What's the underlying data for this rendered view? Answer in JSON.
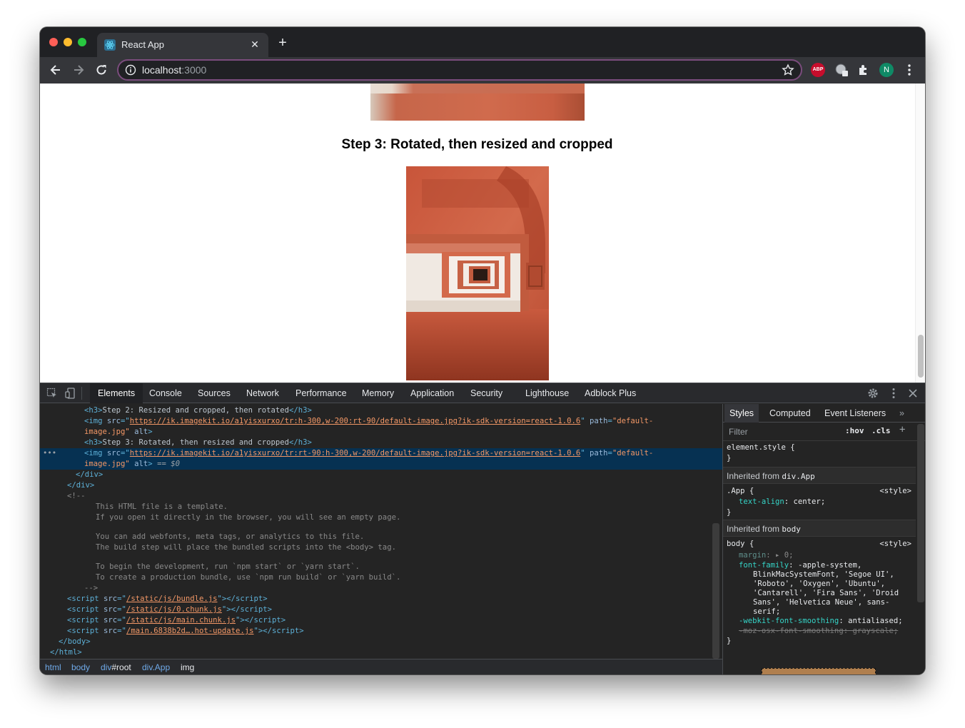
{
  "browser": {
    "tab_title": "React App",
    "url_host": "localhost",
    "url_port": ":3000",
    "profile_initial": "N",
    "abp_label": "ABP"
  },
  "page": {
    "heading": "Step 3: Rotated, then resized and cropped"
  },
  "devtools": {
    "tabs": [
      "Elements",
      "Console",
      "Sources",
      "Network",
      "Performance",
      "Memory",
      "Application",
      "Security",
      "Lighthouse",
      "Adblock Plus"
    ],
    "active_tab": "Elements",
    "code": {
      "h3_step2_text": "Step 2: Resized and cropped, then rotated",
      "img1_src": "https://ik.imagekit.io/a1yisxurxo/tr:h-300,w-200:rt-90/default-image.jpg?ik-sdk-version=react-1.0.6",
      "img_path_val_a": "\"default-",
      "img_path_val_b": "image.jpg\"",
      "h3_step3_text": "Step 3: Rotated, then resized and cropped",
      "img2_src": "https://ik.imagekit.io/a1yisxurxo/tr:rt-90:h-300,w-200/default-image.jpg?ik-sdk-version=react-1.0.6",
      "selected_marker": "== $0",
      "comment_lines": [
        "This HTML file is a template.",
        "If you open it directly in the browser, you will see an empty page.",
        "",
        "You can add webfonts, meta tags, or analytics to this file.",
        "The build step will place the bundled scripts into the <body> tag.",
        "",
        "To begin the development, run `npm start` or `yarn start`.",
        "To create a production bundle, use `npm run build` or `yarn build`."
      ],
      "scripts": [
        "/static/js/bundle.js",
        "/static/js/0.chunk.js",
        "/static/js/main.chunk.js",
        "/main.6838b2d….hot-update.js"
      ]
    },
    "breadcrumbs": {
      "html": "html",
      "body": "body",
      "div_root_tag": "div",
      "div_root_id": "#root",
      "div_app": "div.App",
      "img": "img"
    },
    "sidebar": {
      "tabs": [
        "Styles",
        "Computed",
        "Event Listeners"
      ],
      "filter_placeholder": "Filter",
      "hov": ":hov",
      "cls": ".cls",
      "element_style": "element.style {",
      "close_brace": "}",
      "inherited_app_label": "Inherited from",
      "inherited_app_target": "div.App",
      "app_selector": ".App {",
      "style_origin": "<style>",
      "text_align_prop": "text-align",
      "text_align_val": "center;",
      "inherited_body_label": "Inherited from",
      "inherited_body_target": "body",
      "body_selector": "body {",
      "margin_prop": "margin",
      "margin_val": "0;",
      "font_family_prop": "font-family",
      "font_family_lines": [
        "-apple-system,",
        "BlinkMacSystemFont, 'Segoe UI',",
        "'Roboto', 'Oxygen', 'Ubuntu',",
        "'Cantarell', 'Fira Sans', 'Droid",
        "Sans', 'Helvetica Neue', sans-",
        "serif;"
      ],
      "webkit_prop": "-webkit-font-smoothing",
      "webkit_val": "antialiased;",
      "moz_struck": "-moz-osx-font-smoothing: grayscale;"
    }
  },
  "colors": {
    "accent_omnibox": "#7b4c7d",
    "selection": "#063152",
    "tag": "#5db0d7",
    "value": "#f29766"
  }
}
